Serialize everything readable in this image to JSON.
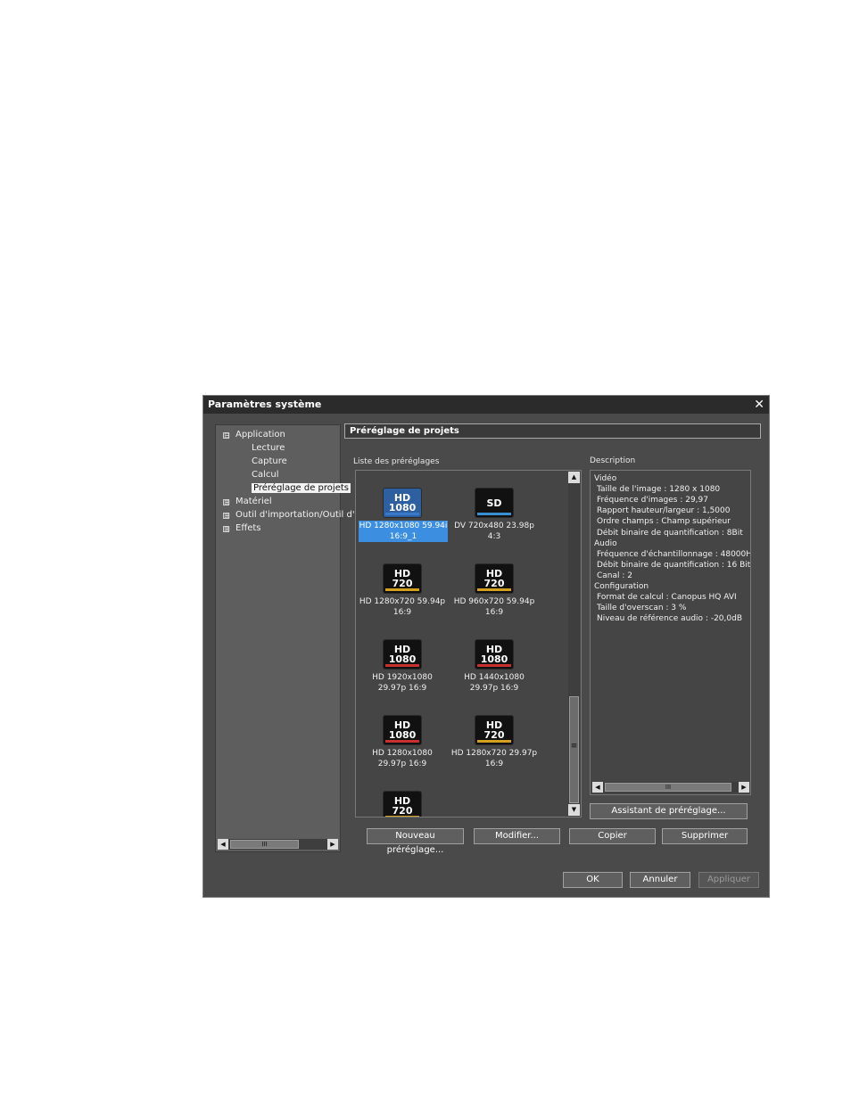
{
  "window": {
    "title": "Paramètres système"
  },
  "tree": {
    "items": [
      {
        "label": "Application",
        "expander": "⊟"
      },
      {
        "label": "Lecture"
      },
      {
        "label": "Capture"
      },
      {
        "label": "Calcul"
      },
      {
        "label": "Préréglage de projets",
        "selected": true
      },
      {
        "label": "Matériel",
        "expander": "⊞"
      },
      {
        "label": "Outil d'importation/Outil d'",
        "expander": "⊞"
      },
      {
        "label": "Effets",
        "expander": "⊞"
      }
    ]
  },
  "section": {
    "title": "Préréglage de projets"
  },
  "presets": {
    "label": "Liste des préréglages",
    "items": [
      {
        "badge_top": "HD",
        "badge_bottom": "1080",
        "line1": "HD 1280x1080 59.94i",
        "line2": "16:9_1",
        "selected": true,
        "stripe_color": "#3a78c8",
        "icon_color": "#2e5fa0"
      },
      {
        "badge_top": "SD",
        "badge_bottom": "",
        "line1": "DV 720x480 23.98p",
        "line2": "4:3",
        "stripe_color": "#3a8fd0",
        "icon_color": "#111111"
      },
      {
        "badge_top": "HD",
        "badge_bottom": "720",
        "line1": "HD 1280x720 59.94p",
        "line2": "16:9",
        "stripe_color": "#d4a020",
        "icon_color": "#111111"
      },
      {
        "badge_top": "HD",
        "badge_bottom": "720",
        "line1": "HD 960x720 59.94p",
        "line2": "16:9",
        "stripe_color": "#d4a020",
        "icon_color": "#111111"
      },
      {
        "badge_top": "HD",
        "badge_bottom": "1080",
        "line1": "HD 1920x1080",
        "line2": "29.97p 16:9",
        "stripe_color": "#c83030",
        "icon_color": "#111111"
      },
      {
        "badge_top": "HD",
        "badge_bottom": "1080",
        "line1": "HD 1440x1080",
        "line2": "29.97p 16:9",
        "stripe_color": "#c83030",
        "icon_color": "#111111"
      },
      {
        "badge_top": "HD",
        "badge_bottom": "1080",
        "line1": "HD 1280x1080",
        "line2": "29.97p 16:9",
        "stripe_color": "#c83030",
        "icon_color": "#111111"
      },
      {
        "badge_top": "HD",
        "badge_bottom": "720",
        "line1": "HD 1280x720 29.97p",
        "line2": "16:9",
        "stripe_color": "#d4a020",
        "icon_color": "#111111"
      },
      {
        "badge_top": "HD",
        "badge_bottom": "720",
        "line1": "",
        "line2": "",
        "stripe_color": "#d4a020",
        "icon_color": "#111111"
      }
    ]
  },
  "description": {
    "label": "Description",
    "lines": [
      {
        "text": "Vidéo",
        "indent": false
      },
      {
        "text": "Taille de l'image : 1280 x 1080",
        "indent": true
      },
      {
        "text": "Fréquence d'images : 29,97",
        "indent": true
      },
      {
        "text": "Rapport hauteur/largeur : 1,5000",
        "indent": true
      },
      {
        "text": "Ordre champs : Champ supérieur",
        "indent": true
      },
      {
        "text": "Débit binaire de quantification : 8Bit",
        "indent": true
      },
      {
        "text": "Audio",
        "indent": false
      },
      {
        "text": "Fréquence d'échantillonnage : 48000H",
        "indent": true
      },
      {
        "text": "Débit binaire de quantification : 16 Bit",
        "indent": true
      },
      {
        "text": "Canal : 2",
        "indent": true
      },
      {
        "text": "Configuration",
        "indent": false
      },
      {
        "text": "Format de calcul : Canopus HQ AVI",
        "indent": true
      },
      {
        "text": "Taille d'overscan : 3 %",
        "indent": true
      },
      {
        "text": "Niveau de référence audio : -20,0dB",
        "indent": true
      }
    ]
  },
  "buttons": {
    "wizard": "Assistant de préréglage...",
    "new": "Nouveau préréglage...",
    "modify": "Modifier...",
    "copy": "Copier",
    "delete": "Supprimer",
    "ok": "OK",
    "cancel": "Annuler",
    "apply": "Appliquer"
  },
  "glyphs": {
    "close": "✕",
    "left": "◀",
    "right": "▶",
    "up": "▲",
    "down": "▼",
    "grip_h": "III",
    "grip_v": "≡"
  }
}
